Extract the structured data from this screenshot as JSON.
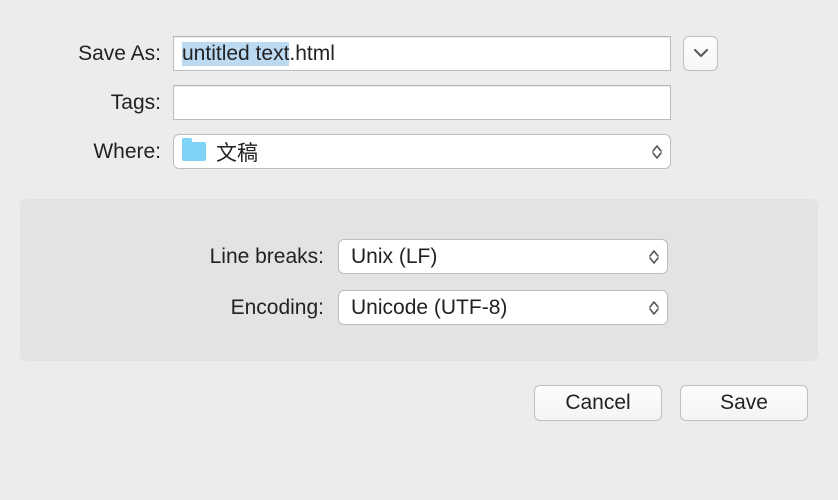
{
  "labels": {
    "save_as": "Save As:",
    "tags": "Tags:",
    "where": "Where:",
    "line_breaks": "Line breaks:",
    "encoding": "Encoding:"
  },
  "values": {
    "filename_base": "untitled text",
    "filename_ext": ".html",
    "tags": "",
    "where": "文稿",
    "line_breaks": "Unix (LF)",
    "encoding": "Unicode (UTF-8)"
  },
  "buttons": {
    "cancel": "Cancel",
    "save": "Save"
  }
}
